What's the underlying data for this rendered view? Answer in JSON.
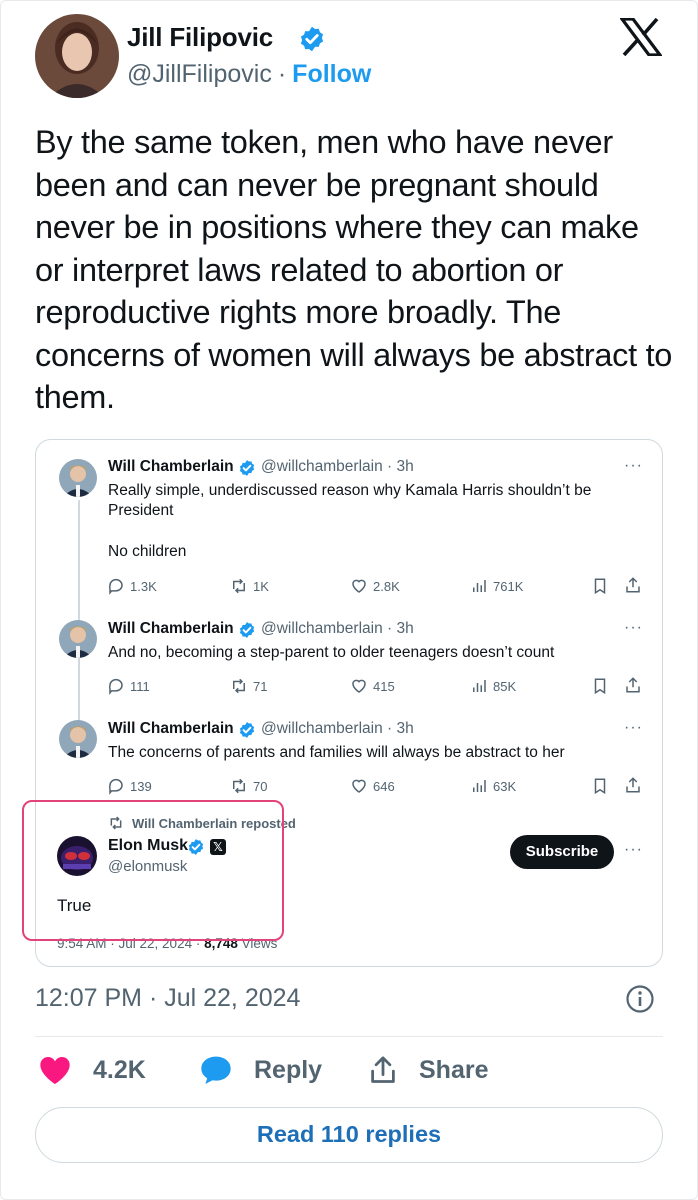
{
  "tweet": {
    "author_name": "Jill Filipovic",
    "author_handle": "@JillFilipovic",
    "separator": "·",
    "follow_label": "Follow",
    "text": "By the same token, men who have never been and can never be pregnant should never be in positions where they can make or interpret laws related to abortion or reproductive rights more broadly. The concerns of women will always be abstract to them.",
    "timestamp": "12:07 PM · Jul 22, 2024",
    "likes_count": "4.2K",
    "reply_label": "Reply",
    "share_label": "Share",
    "read_replies_label": "Read 110 replies",
    "like_color": "#f91880",
    "brand_color": "#1d9bf0",
    "platform_icon": "x-logo-icon"
  },
  "quoted_thread": {
    "posts": [
      {
        "author": "Will Chamberlain",
        "handle_time": "@willchamberlain · 3h",
        "text_line1": "Really simple, underdiscussed reason why Kamala Harris shouldn’t be",
        "text_line2": "President",
        "text_line3": "No children",
        "replies": "1.3K",
        "reposts": "1K",
        "likes": "2.8K",
        "views": "761K"
      },
      {
        "author": "Will Chamberlain",
        "handle_time": "@willchamberlain · 3h",
        "text_line1": "And no, becoming a step-parent to older teenagers doesn’t count",
        "replies": "111",
        "reposts": "71",
        "likes": "415",
        "views": "85K"
      },
      {
        "author": "Will Chamberlain",
        "handle_time": "@willchamberlain · 3h",
        "text_line1": "The concerns of parents and families will always be abstract to her",
        "replies": "139",
        "reposts": "70",
        "likes": "646",
        "views": "63K"
      }
    ],
    "repost_notice": "Will Chamberlain reposted",
    "repost": {
      "author": "Elon Musk",
      "handle": "@elonmusk",
      "affiliate_badge": "𝕏",
      "subscribe_label": "Subscribe",
      "text": "True",
      "stamp_time": "9:54 AM · Jul 22, 2024 · ",
      "stamp_views": "8,748",
      "stamp_views_label": " Views"
    },
    "more_label": "···",
    "highlight_color": "#e2437a"
  }
}
